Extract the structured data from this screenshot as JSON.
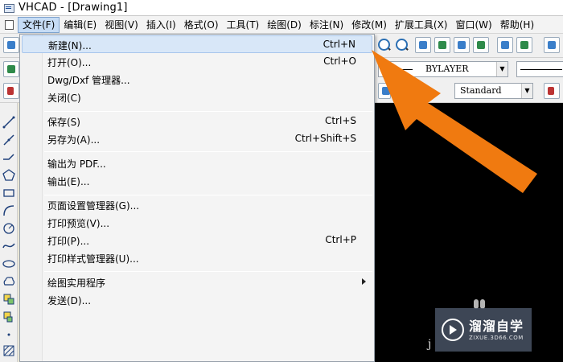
{
  "window": {
    "title": "VHCAD - [Drawing1]"
  },
  "menubar": {
    "items": [
      {
        "label": "文件(F)",
        "active": true
      },
      {
        "label": "编辑(E)"
      },
      {
        "label": "视图(V)"
      },
      {
        "label": "插入(I)"
      },
      {
        "label": "格式(O)"
      },
      {
        "label": "工具(T)"
      },
      {
        "label": "绘图(D)"
      },
      {
        "label": "标注(N)"
      },
      {
        "label": "修改(M)"
      },
      {
        "label": "扩展工具(X)"
      },
      {
        "label": "窗口(W)"
      },
      {
        "label": "帮助(H)"
      }
    ]
  },
  "toolbar": {
    "layer_combo_value": "BYLAYER",
    "textstyle_combo_value": "Standard"
  },
  "file_menu": {
    "groups": [
      [
        {
          "label": "新建(N)...",
          "shortcut": "Ctrl+N",
          "highlighted": true
        },
        {
          "label": "打开(O)...",
          "shortcut": "Ctrl+O"
        },
        {
          "label": "Dwg/Dxf 管理器...",
          "shortcut": ""
        },
        {
          "label": "关闭(C)",
          "shortcut": ""
        }
      ],
      [
        {
          "label": "保存(S)",
          "shortcut": "Ctrl+S"
        },
        {
          "label": "另存为(A)...",
          "shortcut": "Ctrl+Shift+S"
        }
      ],
      [
        {
          "label": "输出为 PDF...",
          "shortcut": ""
        },
        {
          "label": "输出(E)...",
          "shortcut": ""
        }
      ],
      [
        {
          "label": "页面设置管理器(G)...",
          "shortcut": ""
        },
        {
          "label": "打印预览(V)...",
          "shortcut": ""
        },
        {
          "label": "打印(P)...",
          "shortcut": "Ctrl+P"
        },
        {
          "label": "打印样式管理器(U)...",
          "shortcut": ""
        }
      ],
      [
        {
          "label": "绘图实用程序",
          "shortcut": "",
          "submenu": true
        },
        {
          "label": "发送(D)...",
          "shortcut": ""
        }
      ]
    ]
  },
  "annotation": {
    "arrow_color": "#f07a10"
  },
  "watermark": {
    "name": "溜溜自学",
    "url": "ZIXUE.3D66.COM",
    "stray_glyph": "j"
  }
}
